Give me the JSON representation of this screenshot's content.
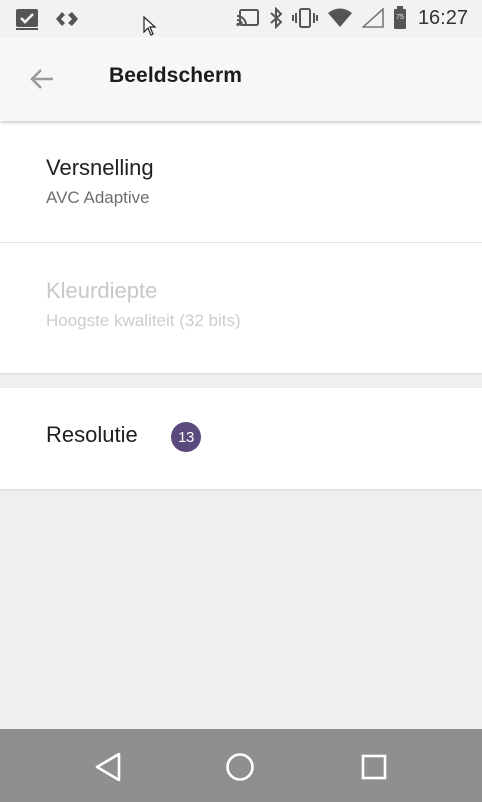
{
  "status_bar": {
    "left_icons": [
      "checkbox-notification-icon",
      "diamond-arrows-icon"
    ],
    "right_icons": [
      "cast-icon",
      "bluetooth-icon",
      "vibrate-icon",
      "wifi-icon",
      "signal-icon",
      "battery-icon"
    ],
    "battery_level": "75",
    "time": "16:27"
  },
  "app_bar": {
    "back_icon": "arrow-left-icon",
    "title": "Beeldscherm"
  },
  "preferences": {
    "versnelling": {
      "title": "Versnelling",
      "summary": "AVC Adaptive"
    },
    "kleurdiepte": {
      "title": "Kleurdiepte",
      "summary": "Hoogste kwaliteit (32 bits)",
      "enabled": false
    },
    "resolutie": {
      "title": "Resolutie",
      "badge": "13"
    }
  },
  "nav_bar": {
    "icons": [
      "nav-back-icon",
      "nav-home-icon",
      "nav-recents-icon"
    ]
  },
  "colors": {
    "badge": "#5b4a7d",
    "nav_bar": "#8f8f8f",
    "background": "#efefef"
  }
}
